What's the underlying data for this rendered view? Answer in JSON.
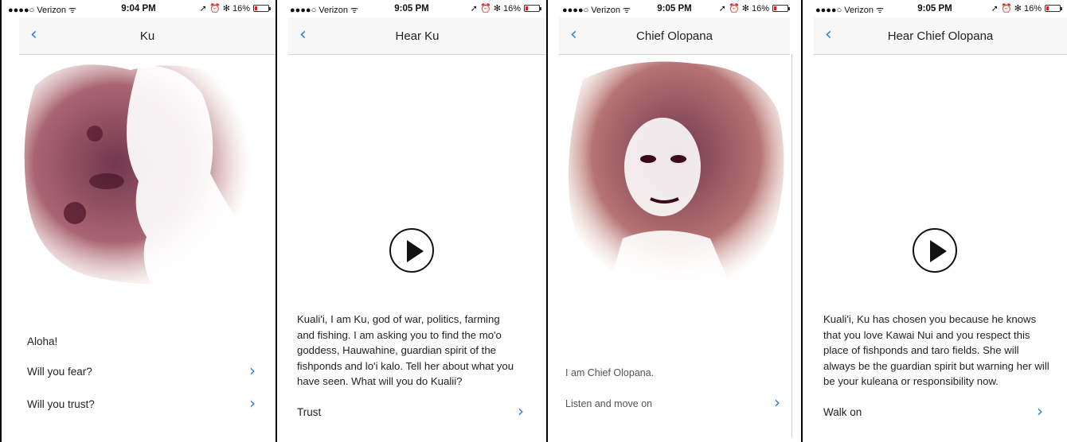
{
  "colors": {
    "accent": "#2a7fd4",
    "battery_low": "#e02020",
    "portrait_ink": "#8a2a4a"
  },
  "status_bars": [
    {
      "carrier": "●●●●○ Verizon ᯤ",
      "time": "9:04 PM",
      "indicators": "➚ ⏰ ✻ 16%",
      "battery_percent": 16
    },
    {
      "carrier": "●●●●○ Verizon ᯤ",
      "time": "9:05 PM",
      "indicators": "➚ ⏰ ✻ 16%",
      "battery_percent": 16
    },
    {
      "carrier": "●●●●○ Verizon ᯤ",
      "time": "9:05 PM",
      "indicators": "➚ ⏰ ✻ 16%",
      "battery_percent": 16
    },
    {
      "carrier": "●●●●○ Verizon ᯤ",
      "time": "9:05 PM",
      "indicators": "➚ ⏰ ✻ 16%",
      "battery_percent": 16
    }
  ],
  "screens": [
    {
      "title": "Ku",
      "back_icon": "‹",
      "greeting": "Aloha!",
      "options": [
        "Will you fear?",
        "Will you trust?"
      ],
      "chevron": "›"
    },
    {
      "title": "Hear Ku",
      "back_icon": "‹",
      "transcript": "Kuali'i, I am Ku, god of war, politics, farming and fishing. I am asking you to find the mo'o goddess, Hauwahine, guardian spirit of the fishponds and lo'i kalo. Tell her about what you have seen. What will you do Kualii?",
      "option": "Trust",
      "chevron": "›"
    },
    {
      "title": "Chief Olopana",
      "back_icon": "‹",
      "intro": "I am Chief Olopana.",
      "option": "Listen and move on",
      "chevron": "›"
    },
    {
      "title": "Hear Chief Olopana",
      "back_icon": "‹",
      "transcript": "Kuali'i, Ku has chosen you because he knows that you love Kawai Nui and you respect this place of fishponds and taro fields. She will always be the guardian spirit but warning her will be your kuleana or responsibility now.",
      "option": "Walk on",
      "chevron": "›"
    }
  ]
}
